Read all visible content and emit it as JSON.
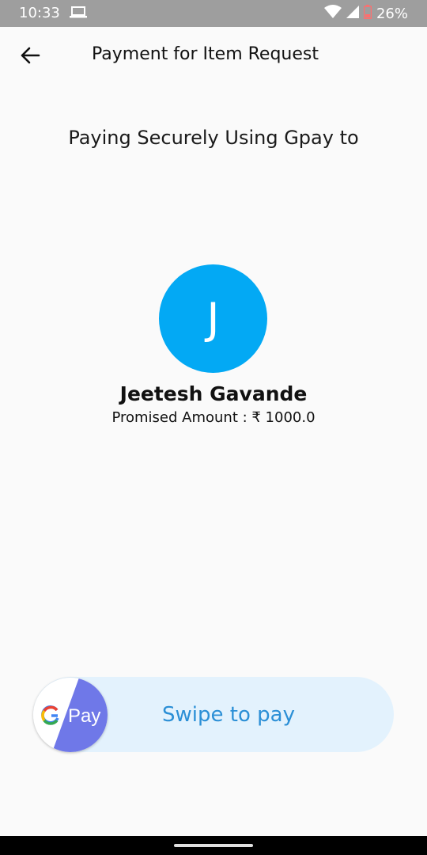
{
  "status_bar": {
    "time": "10:33",
    "battery": "26%"
  },
  "app_bar": {
    "title": "Payment for Item Request"
  },
  "main": {
    "subtitle": "Paying Securely Using Gpay to",
    "avatar_initial": "J",
    "payee_name": "Jeetesh Gavande",
    "promised_amount": "Promised Amount : ₹ 1000.0"
  },
  "swipe": {
    "label": "Swipe to pay",
    "thumb_label": "Pay"
  },
  "colors": {
    "avatar": "#03a9f4",
    "swipe_track": "#e3f2fd",
    "swipe_text": "#2b8fd6",
    "gpay_purple": "#6f78e8"
  },
  "icons": {
    "back": "arrow-left-icon",
    "laptop": "laptop-icon",
    "wifi": "wifi-icon",
    "signal": "signal-icon",
    "battery": "battery-icon"
  }
}
